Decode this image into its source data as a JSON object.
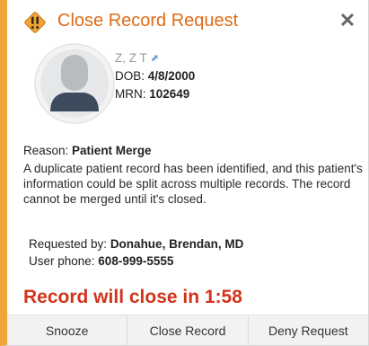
{
  "header": {
    "title": "Close Record Request",
    "close_icon": "close-icon",
    "warning_icon": "exclamation-warning-icon"
  },
  "patient": {
    "name": "Z, Z T",
    "dob_label": "DOB: ",
    "dob_value": "4/8/2000",
    "mrn_label": "MRN: ",
    "mrn_value": "102649"
  },
  "reason": {
    "label": "Reason: ",
    "value": "Patient Merge",
    "description": "A duplicate patient record has been identified, and this patient's information could be split across multiple records. The record cannot be merged until it's closed."
  },
  "request": {
    "requested_by_label": "Requested by: ",
    "requested_by_value": "Donahue, Brendan, MD",
    "phone_label": "User phone: ",
    "phone_value": "608-999-5555"
  },
  "countdown": "Record will close in 1:58",
  "buttons": {
    "snooze": "Snooze",
    "close_record": "Close Record",
    "deny_request": "Deny Request"
  },
  "colors": {
    "accent": "#f0a53b",
    "title": "#e06b18",
    "countdown": "#d2341b"
  }
}
